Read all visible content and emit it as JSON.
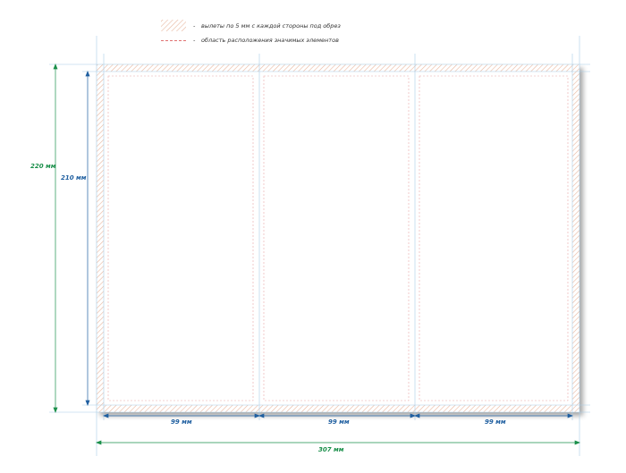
{
  "legend": {
    "bleed": {
      "marker": "-",
      "text": "вылеты по 5 мм с каждой стороны под обрез"
    },
    "safe_area": {
      "marker": "-",
      "text": "область расположения значимых элементов"
    }
  },
  "dimensions": {
    "bleed_height": "220 мм",
    "trim_height": "210 мм",
    "panel_widths": [
      "99 мм",
      "99 мм",
      "99 мм"
    ],
    "bleed_width": "307 мм"
  },
  "colors": {
    "hatch": "#e8b8a0",
    "guide": "#a8cde8",
    "safe_line": "#e07070",
    "dim_blue": "#1f5fa0",
    "dim_green": "#1a8f4a"
  }
}
